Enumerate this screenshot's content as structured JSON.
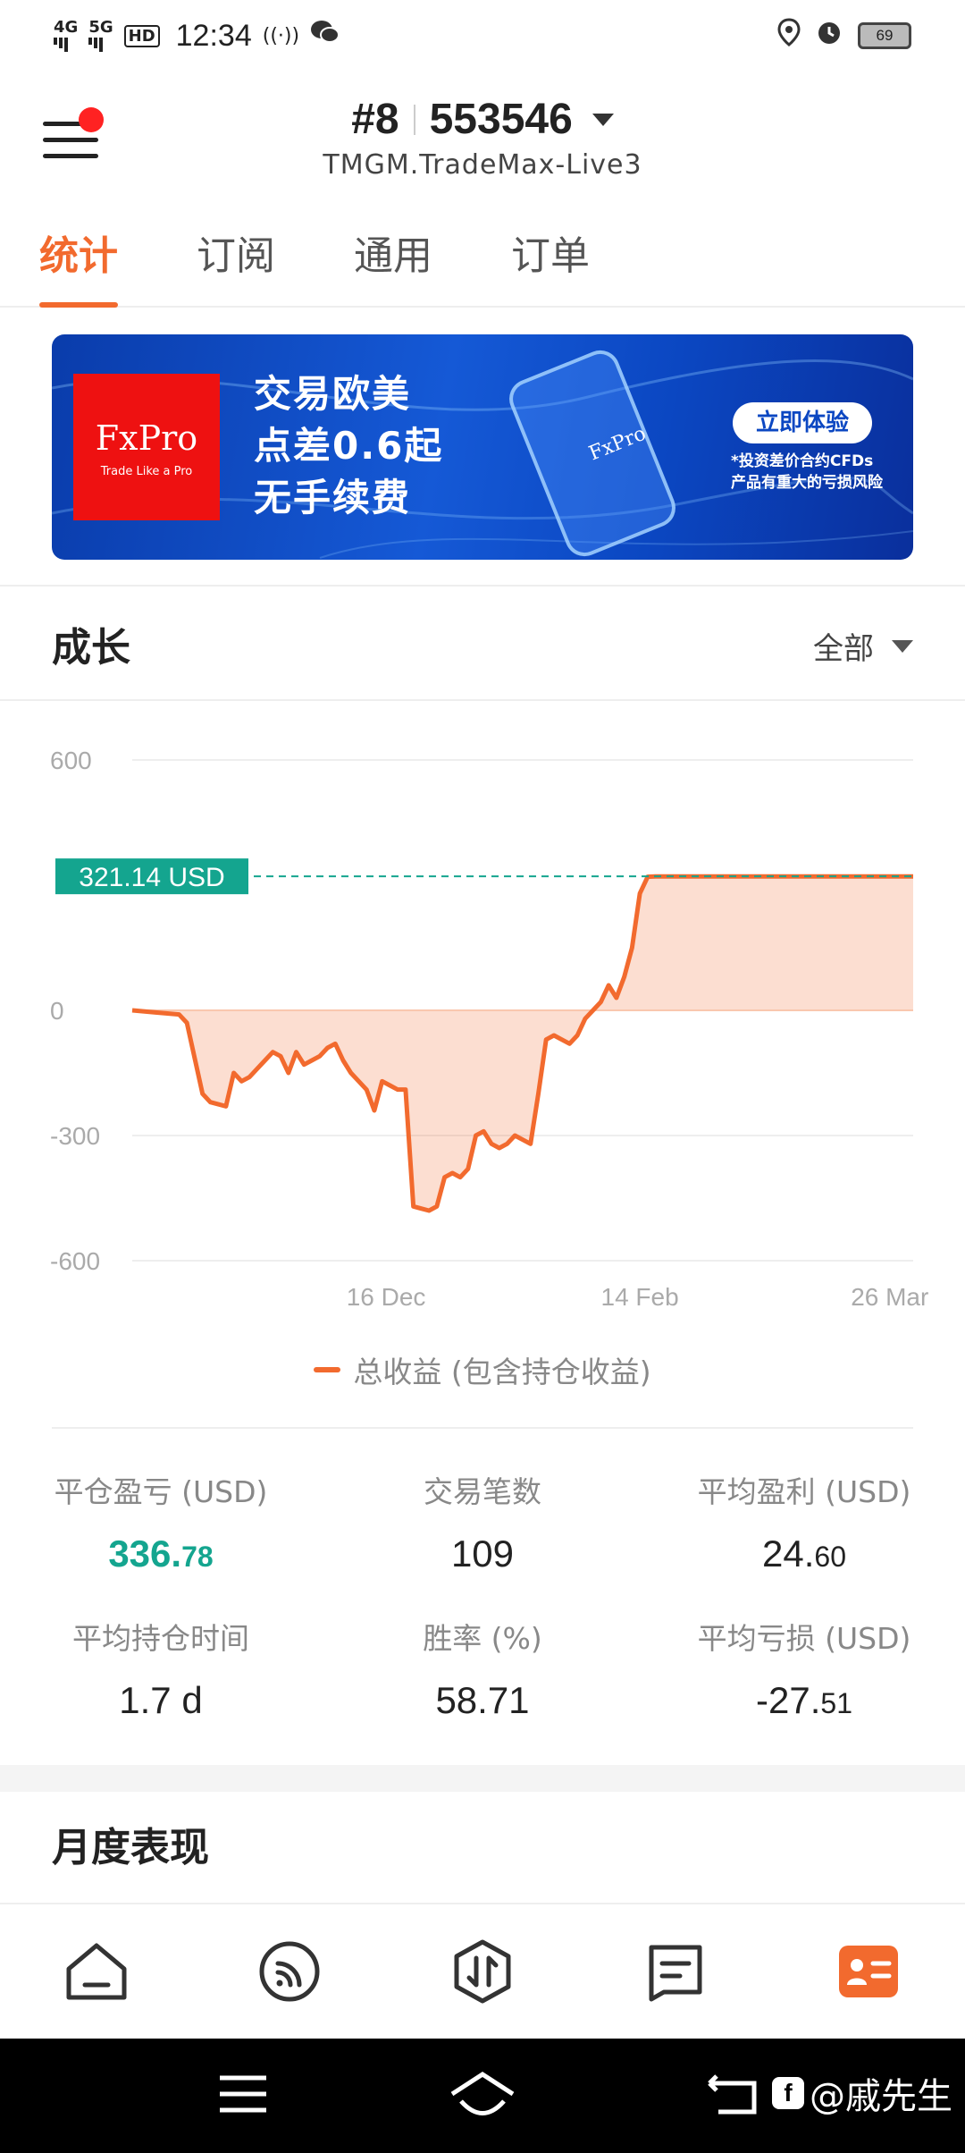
{
  "status_bar": {
    "network_1": "4G",
    "network_2": "5G",
    "hd": "HD",
    "time": "12:34",
    "battery": "69"
  },
  "header": {
    "account_number": "#8",
    "account_id": "553546",
    "server": "TMGM.TradeMax-Live3"
  },
  "tabs": [
    {
      "label": "统计",
      "active": true
    },
    {
      "label": "订阅",
      "active": false
    },
    {
      "label": "通用",
      "active": false
    },
    {
      "label": "订单",
      "active": false
    }
  ],
  "banner": {
    "brand": "FxPro",
    "tagline": "Trade Like a Pro",
    "promo_line1": "交易欧美",
    "promo_line2": "点差0.6起",
    "promo_line3": "无手续费",
    "cta": "立即体验",
    "risk_line1": "*投资差价合约CFDs",
    "risk_line2": "产品有重大的亏损风险"
  },
  "growth": {
    "title": "成长",
    "filter": "全部"
  },
  "chart_data": {
    "type": "area",
    "current_label": "321.14 USD",
    "current_value": 321.14,
    "y_ticks": [
      "600",
      "0",
      "-300",
      "-600"
    ],
    "ylim": [
      -600,
      600
    ],
    "x_ticks": [
      "16 Dec",
      "14 Feb",
      "26 Mar"
    ],
    "x_tick_pos": [
      0.325,
      0.65,
      0.97
    ],
    "series": [
      {
        "name": "总收益 (包含持仓收益)",
        "color": "#f26a2e",
        "x": [
          0,
          0.03,
          0.06,
          0.07,
          0.09,
          0.1,
          0.12,
          0.13,
          0.14,
          0.15,
          0.16,
          0.17,
          0.18,
          0.19,
          0.2,
          0.21,
          0.22,
          0.23,
          0.24,
          0.25,
          0.26,
          0.27,
          0.28,
          0.29,
          0.3,
          0.31,
          0.32,
          0.33,
          0.34,
          0.35,
          0.36,
          0.37,
          0.38,
          0.39,
          0.4,
          0.41,
          0.42,
          0.43,
          0.44,
          0.45,
          0.46,
          0.47,
          0.48,
          0.49,
          0.5,
          0.51,
          0.52,
          0.53,
          0.54,
          0.55,
          0.56,
          0.57,
          0.58,
          0.59,
          0.6,
          0.61,
          0.62,
          0.63,
          0.64,
          0.65,
          0.66,
          0.67,
          0.68,
          0.69,
          0.7,
          0.71,
          0.72,
          0.73,
          0.74,
          0.75,
          0.76,
          0.77,
          0.78,
          0.79,
          0.8,
          0.81,
          0.82,
          0.83,
          0.84,
          0.85,
          0.86,
          0.87,
          0.88,
          0.89,
          0.9,
          0.91,
          0.92,
          0.93,
          0.94,
          0.95,
          0.96,
          0.97,
          0.98,
          0.99,
          1.0
        ],
        "values": [
          0,
          -5,
          -10,
          -30,
          -200,
          -220,
          -230,
          -150,
          -170,
          -160,
          -140,
          -120,
          -100,
          -110,
          -150,
          -100,
          -130,
          -120,
          -110,
          -90,
          -80,
          -120,
          -150,
          -170,
          -190,
          -240,
          -170,
          -180,
          -190,
          -190,
          -470,
          -475,
          -480,
          -470,
          -400,
          -390,
          -400,
          -380,
          -300,
          -290,
          -320,
          -330,
          -320,
          -300,
          -310,
          -320,
          -200,
          -70,
          -60,
          -70,
          -80,
          -60,
          -20,
          0,
          20,
          60,
          30,
          80,
          150,
          280,
          320,
          321,
          321,
          321,
          321,
          321,
          321,
          321,
          321,
          321,
          321,
          321,
          321,
          321,
          321,
          321,
          321,
          321,
          321,
          321,
          321,
          321,
          321,
          321,
          321,
          321,
          321,
          321,
          321,
          321,
          321,
          321,
          321,
          321,
          321
        ]
      }
    ],
    "legend_position": "bottom",
    "grid": true
  },
  "stats": [
    {
      "label": "平仓盈亏 (USD)",
      "value_main": "336.",
      "value_small": "78",
      "positive": true
    },
    {
      "label": "交易笔数",
      "value_main": "109",
      "value_small": "",
      "positive": false
    },
    {
      "label": "平均盈利 (USD)",
      "value_main": "24.",
      "value_small": "60",
      "positive": false
    },
    {
      "label": "平均持仓时间",
      "value_main": "1.7 d",
      "value_small": "",
      "positive": false
    },
    {
      "label": "胜率 (%)",
      "value_main": "58.71",
      "value_small": "",
      "positive": false
    },
    {
      "label": "平均亏损 (USD)",
      "value_main": "-27.",
      "value_small": "51",
      "positive": false
    }
  ],
  "monthly": {
    "title": "月度表现"
  },
  "bottom_nav": [
    "home-icon",
    "feed-icon",
    "trade-icon",
    "message-icon",
    "profile-card-icon"
  ],
  "watermark": "@戚先生",
  "colors": {
    "accent": "#f26a2e",
    "positive": "#14a58f"
  }
}
